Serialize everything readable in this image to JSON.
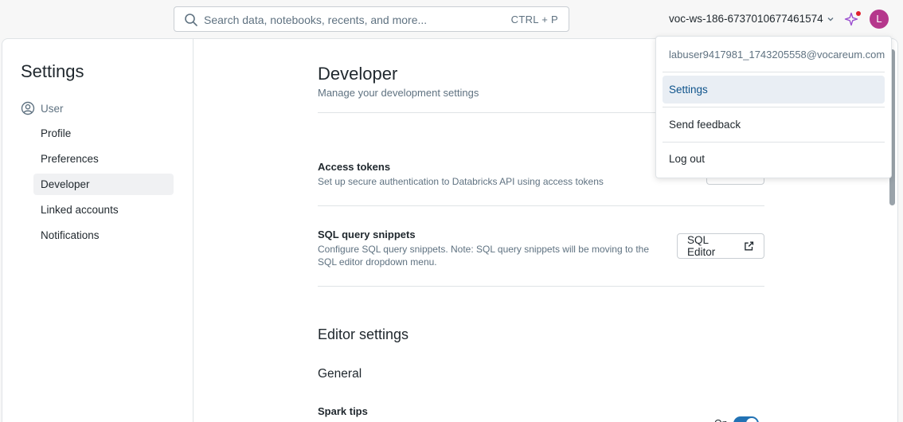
{
  "search": {
    "placeholder": "Search data, notebooks, recents, and more...",
    "shortcut": "CTRL + P"
  },
  "header": {
    "workspace": "voc-ws-186-6737010677461574",
    "avatar_initial": "L"
  },
  "sidebar": {
    "title": "Settings",
    "section": "User",
    "items": [
      {
        "label": "Profile"
      },
      {
        "label": "Preferences"
      },
      {
        "label": "Developer"
      },
      {
        "label": "Linked accounts"
      },
      {
        "label": "Notifications"
      }
    ],
    "active_index": 2
  },
  "main": {
    "title": "Developer",
    "subtitle": "Manage your development settings",
    "access_tokens": {
      "title": "Access tokens",
      "description": "Set up secure authentication to Databricks API using access tokens"
    },
    "sql_snippets": {
      "title": "SQL query snippets",
      "description": "Configure SQL query snippets. Note: SQL query snippets will be moving to the SQL editor dropdown menu.",
      "button": "SQL Editor"
    },
    "editor_settings": "Editor settings",
    "general": "General",
    "spark_tips": {
      "title": "Spark tips",
      "description": "",
      "toggle_label": "On",
      "toggle_on": true
    }
  },
  "user_menu": {
    "email": "labuser9417981_1743205558@vocareum.com",
    "items": [
      {
        "label": "Settings"
      },
      {
        "label": "Send feedback"
      },
      {
        "label": "Log out"
      }
    ]
  },
  "colors": {
    "accent": "#2272b4",
    "avatar_bg": "#b5378c",
    "menu_active_bg": "#e9eef4"
  }
}
